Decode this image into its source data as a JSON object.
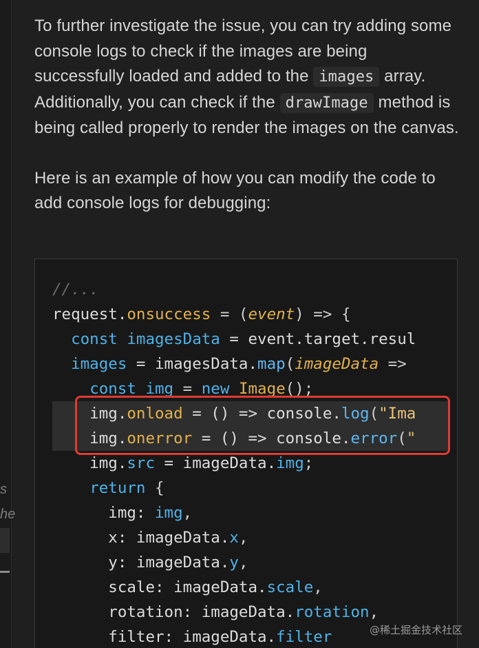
{
  "left_strip": {
    "fragment_1": "s",
    "fragment_2": "he"
  },
  "chat": {
    "paragraph_1": {
      "text_a": "To further investigate the issue, you can try adding some console logs to check if the images are being successfully loaded and added to the ",
      "code_a": "images",
      "text_b": " array. Additionally, you can check if the ",
      "code_b": "drawImage",
      "text_c": " method is being called properly to render the images on the canvas."
    },
    "paragraph_2": "Here is an example of how you can modify the code to add console logs for debugging:"
  },
  "code_block": {
    "lines": [
      [
        {
          "t": "//...",
          "c": "comment"
        }
      ],
      [
        {
          "t": "request.",
          "c": "plain"
        },
        {
          "t": "onsuccess",
          "c": "prop"
        },
        {
          "t": " = (",
          "c": "op"
        },
        {
          "t": "event",
          "c": "param"
        },
        {
          "t": ") => {",
          "c": "op"
        }
      ],
      [
        {
          "t": "  ",
          "c": "plain"
        },
        {
          "t": "const",
          "c": "kw"
        },
        {
          "t": " ",
          "c": "plain"
        },
        {
          "t": "imagesData",
          "c": "var"
        },
        {
          "t": " = event.target.resul",
          "c": "plain"
        }
      ],
      [
        {
          "t": "  ",
          "c": "plain"
        },
        {
          "t": "images",
          "c": "var"
        },
        {
          "t": " = imagesData.",
          "c": "plain"
        },
        {
          "t": "map",
          "c": "fn"
        },
        {
          "t": "(",
          "c": "op"
        },
        {
          "t": "imageData",
          "c": "param"
        },
        {
          "t": " => ",
          "c": "op"
        }
      ],
      [
        {
          "t": "    ",
          "c": "plain"
        },
        {
          "t": "const",
          "c": "kw"
        },
        {
          "t": " ",
          "c": "plain"
        },
        {
          "t": "img",
          "c": "var"
        },
        {
          "t": " = ",
          "c": "op"
        },
        {
          "t": "new",
          "c": "kw"
        },
        {
          "t": " ",
          "c": "plain"
        },
        {
          "t": "Image",
          "c": "cls"
        },
        {
          "t": "();",
          "c": "op"
        }
      ],
      [
        {
          "t": "    img.",
          "c": "plain"
        },
        {
          "t": "onload",
          "c": "prop"
        },
        {
          "t": " = () => console.",
          "c": "plain"
        },
        {
          "t": "log",
          "c": "fn"
        },
        {
          "t": "(",
          "c": "op"
        },
        {
          "t": "\"Ima",
          "c": "str"
        }
      ],
      [
        {
          "t": "    img.",
          "c": "plain"
        },
        {
          "t": "onerror",
          "c": "prop"
        },
        {
          "t": " = () => console.",
          "c": "plain"
        },
        {
          "t": "error",
          "c": "fn"
        },
        {
          "t": "(",
          "c": "op"
        },
        {
          "t": "\"",
          "c": "str"
        }
      ],
      [
        {
          "t": "    img.",
          "c": "plain"
        },
        {
          "t": "src",
          "c": "member"
        },
        {
          "t": " = imageData.",
          "c": "plain"
        },
        {
          "t": "img",
          "c": "member"
        },
        {
          "t": ";",
          "c": "op"
        }
      ],
      [
        {
          "t": "    ",
          "c": "plain"
        },
        {
          "t": "return",
          "c": "kw"
        },
        {
          "t": " {",
          "c": "op"
        }
      ],
      [
        {
          "t": "      img: ",
          "c": "plain"
        },
        {
          "t": "img",
          "c": "var"
        },
        {
          "t": ",",
          "c": "op"
        }
      ],
      [
        {
          "t": "      x: imageData.",
          "c": "plain"
        },
        {
          "t": "x",
          "c": "member"
        },
        {
          "t": ",",
          "c": "op"
        }
      ],
      [
        {
          "t": "      y: imageData.",
          "c": "plain"
        },
        {
          "t": "y",
          "c": "member"
        },
        {
          "t": ",",
          "c": "op"
        }
      ],
      [
        {
          "t": "      scale: imageData.",
          "c": "plain"
        },
        {
          "t": "scale",
          "c": "member"
        },
        {
          "t": ",",
          "c": "op"
        }
      ],
      [
        {
          "t": "      rotation: imageData.",
          "c": "plain"
        },
        {
          "t": "rotation",
          "c": "member"
        },
        {
          "t": ",",
          "c": "op"
        }
      ],
      [
        {
          "t": "      filter: imageData.",
          "c": "plain"
        },
        {
          "t": "filter",
          "c": "member"
        }
      ]
    ],
    "highlighted_lines": [
      5,
      6
    ],
    "accent_color": "#e03b32"
  },
  "watermark": "@稀土掘金技术社区"
}
